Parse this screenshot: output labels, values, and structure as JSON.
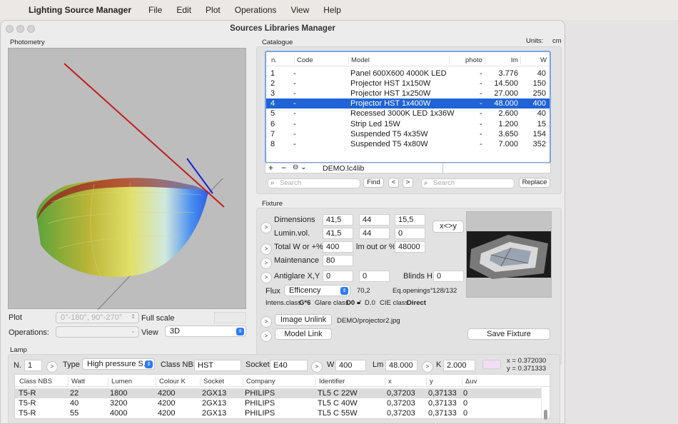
{
  "menubar": {
    "app": "Lighting Source Manager",
    "items": [
      "File",
      "Edit",
      "Plot",
      "Operations",
      "View",
      "Help"
    ]
  },
  "window": {
    "title": "Sources Libraries Manager"
  },
  "photometry": {
    "label": "Photometry",
    "plot_label": "Plot",
    "plot_value": "0°-180°, 90°-270°",
    "full_scale": "Full scale",
    "operations_label": "Operations:",
    "view_label": "View",
    "view_value": "3D"
  },
  "units": {
    "label": "Units:",
    "value": "cm"
  },
  "catalogue": {
    "label": "Catalogue",
    "columns": [
      "n.",
      "Code",
      "Model",
      "photo",
      "lm",
      "W"
    ],
    "rows": [
      {
        "n": "1",
        "code": "-",
        "model": "Panel 600X600 4000K LED",
        "photo": "-",
        "lm": "3.776",
        "w": "40"
      },
      {
        "n": "2",
        "code": "-",
        "model": "Projector HST 1x150W",
        "photo": "-",
        "lm": "14.500",
        "w": "150"
      },
      {
        "n": "3",
        "code": "-",
        "model": "Projector HST 1x250W",
        "photo": "-",
        "lm": "27.000",
        "w": "250"
      },
      {
        "n": "4",
        "code": "-",
        "model": "Projector HST 1x400W",
        "photo": "-",
        "lm": "48.000",
        "w": "400"
      },
      {
        "n": "5",
        "code": "-",
        "model": "Recessed 3000K LED 1x36W",
        "photo": "-",
        "lm": "2.600",
        "w": "40"
      },
      {
        "n": "6",
        "code": "-",
        "model": "Strip Led 15W",
        "photo": "-",
        "lm": "1.200",
        "w": "15"
      },
      {
        "n": "7",
        "code": "-",
        "model": "Suspended T5  4x35W",
        "photo": "-",
        "lm": "3.650",
        "w": "154"
      },
      {
        "n": "8",
        "code": "-",
        "model": "Suspended T5  4x80W",
        "photo": "-",
        "lm": "7.000",
        "w": "352"
      }
    ],
    "selected_row": 3,
    "file": "DEMO.lc4lib",
    "search_placeholder": "Search",
    "find": "Find",
    "prev": "<",
    "next": ">",
    "replace_placeholder": "Search",
    "replace": "Replace",
    "plus": "+",
    "minus": "−"
  },
  "fixture": {
    "label": "Fixture",
    "dimensions_label": "Dimensions",
    "dimensions": [
      "41,5",
      "44",
      "15,5"
    ],
    "luminvol_label": "Lumin.vol.",
    "luminvol": [
      "41,5",
      "44",
      "0"
    ],
    "swap": "x<>y",
    "total_w_label": "Total W or +%",
    "total_w": "400",
    "lm_out_label": "lm out or %",
    "lm_out": "48000",
    "maintenance_label": "Maintenance",
    "maintenance": "80",
    "antiglare_label": "Antiglare X,Y",
    "antiglare": [
      "0",
      "0"
    ],
    "blinds_label": "Blinds H.",
    "blinds": "0",
    "flux_label": "Flux",
    "flux_value": "Efficency",
    "flux_number": "70,2",
    "eq_openings_label": "Eq.openings°",
    "eq_openings": "128/132",
    "intens_label": "Intens.class",
    "intens_value": "G*6",
    "glare_label": "Glare class",
    "glare_value": "D0",
    "d_value": "D.0",
    "cie_label": "CIE class",
    "cie_value": "Direct",
    "image_unlink": "Image Unlink",
    "image_path": "DEMO/projector2.jpg",
    "model_link": "Model Link",
    "save": "Save Fixture"
  },
  "lamp": {
    "label": "Lamp",
    "n_label": "N.",
    "n_value": "1",
    "type_label": "Type",
    "type_value": "High pressure S...",
    "class_label": "Class NBS",
    "class_value": "HST",
    "socket_label": "Socket",
    "socket_value": "E40",
    "w_label": "W",
    "w_value": "400",
    "lm_label": "Lm",
    "lm_value": "48.000",
    "k_label": "K",
    "k_value": "2.000",
    "x_coord": "x = 0.372030",
    "y_coord": "y = 0.371333",
    "swatch_color": "#f1ddf4",
    "columns": [
      "Class NBS",
      "Watt",
      "Lumen",
      "Colour K",
      "Socket",
      "Company",
      "Identifier",
      "x",
      "y",
      "Δuv"
    ],
    "rows": [
      [
        "T5-R",
        "22",
        "1800",
        "4200",
        "2GX13",
        "PHILIPS",
        "TL5 C 22W",
        "0,37203",
        "0,37133",
        "0"
      ],
      [
        "T5-R",
        "40",
        "3200",
        "4200",
        "2GX13",
        "PHILIPS",
        "TL5 C 40W",
        "0,37203",
        "0,37133",
        "0"
      ],
      [
        "T5-R",
        "55",
        "4000",
        "4200",
        "2GX13",
        "PHILIPS",
        "TL5 C 55W",
        "0,37203",
        "0,37133",
        "0"
      ]
    ]
  },
  "colors": {
    "accent": "#1f63d6",
    "focus": "#7aa3ea"
  }
}
